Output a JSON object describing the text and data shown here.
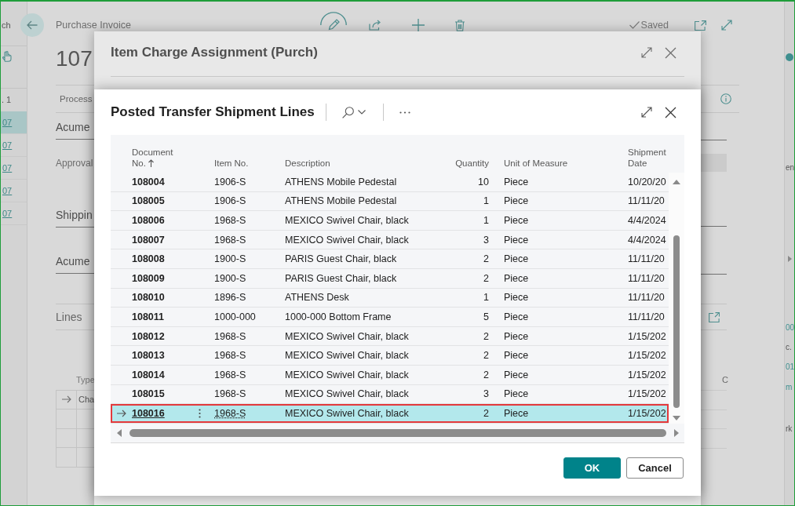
{
  "background_page": {
    "side_list": {
      "heading": "ch",
      "label": ". 1",
      "items": [
        {
          "text": "07",
          "selected": true
        },
        {
          "text": "07",
          "selected": false
        },
        {
          "text": "07",
          "selected": false
        },
        {
          "text": "07",
          "selected": false
        },
        {
          "text": "07",
          "selected": false
        }
      ]
    },
    "breadcrumb": "Purchase Invoice",
    "status": "Saved",
    "title": "107",
    "tab": "Process",
    "sections": [
      {
        "kind": "heading",
        "text": "Acume"
      },
      {
        "kind": "field",
        "text": "Approval"
      },
      {
        "kind": "heading",
        "text": "Shippin"
      },
      {
        "kind": "heading",
        "text": "Acume"
      },
      {
        "kind": "part",
        "text": "Lines"
      }
    ],
    "lines_grid": {
      "header": "Type",
      "cell": "Cha"
    },
    "right_column": {
      "label": "C"
    },
    "side_panel": [
      {
        "kind": "text",
        "text": "en"
      },
      {
        "kind": "link",
        "text": "00"
      },
      {
        "kind": "text",
        "text": "c."
      },
      {
        "kind": "link",
        "text": "01"
      },
      {
        "kind": "link",
        "text": "m"
      },
      {
        "kind": "text",
        "text": "rk"
      }
    ]
  },
  "back_dialog": {
    "title": "Item Charge Assignment (Purch)"
  },
  "dialog": {
    "title": "Posted Transfer Shipment Lines",
    "table": {
      "columns": [
        {
          "label": "Document No.",
          "sorted": true
        },
        {
          "label": "Item No.",
          "sorted": false
        },
        {
          "label": "Description",
          "sorted": false
        },
        {
          "label": "Quantity",
          "sorted": false
        },
        {
          "label": "Unit of Measure",
          "sorted": false
        },
        {
          "label": "Shipment Date",
          "sorted": false
        }
      ],
      "rows": [
        {
          "document_no": "108004",
          "item_no": "1906-S",
          "description": "ATHENS Mobile Pedestal",
          "quantity": "10",
          "unit_of_measure": "Piece",
          "shipment_date": "10/20/20",
          "selected": false,
          "highlighted": false
        },
        {
          "document_no": "108005",
          "item_no": "1906-S",
          "description": "ATHENS Mobile Pedestal",
          "quantity": "1",
          "unit_of_measure": "Piece",
          "shipment_date": "11/11/20",
          "selected": false,
          "highlighted": false
        },
        {
          "document_no": "108006",
          "item_no": "1968-S",
          "description": "MEXICO Swivel Chair, black",
          "quantity": "1",
          "unit_of_measure": "Piece",
          "shipment_date": "4/4/2024",
          "selected": false,
          "highlighted": false
        },
        {
          "document_no": "108007",
          "item_no": "1968-S",
          "description": "MEXICO Swivel Chair, black",
          "quantity": "3",
          "unit_of_measure": "Piece",
          "shipment_date": "4/4/2024",
          "selected": false,
          "highlighted": false
        },
        {
          "document_no": "108008",
          "item_no": "1900-S",
          "description": "PARIS Guest Chair, black",
          "quantity": "2",
          "unit_of_measure": "Piece",
          "shipment_date": "11/11/20",
          "selected": false,
          "highlighted": false
        },
        {
          "document_no": "108009",
          "item_no": "1900-S",
          "description": "PARIS Guest Chair, black",
          "quantity": "2",
          "unit_of_measure": "Piece",
          "shipment_date": "11/11/20",
          "selected": false,
          "highlighted": false
        },
        {
          "document_no": "108010",
          "item_no": "1896-S",
          "description": "ATHENS Desk",
          "quantity": "1",
          "unit_of_measure": "Piece",
          "shipment_date": "11/11/20",
          "selected": false,
          "highlighted": false
        },
        {
          "document_no": "108011",
          "item_no": "1000-000",
          "description": "1000-000 Bottom Frame",
          "quantity": "5",
          "unit_of_measure": "Piece",
          "shipment_date": "11/11/20",
          "selected": false,
          "highlighted": false
        },
        {
          "document_no": "108012",
          "item_no": "1968-S",
          "description": "MEXICO Swivel Chair, black",
          "quantity": "2",
          "unit_of_measure": "Piece",
          "shipment_date": "1/15/202",
          "selected": false,
          "highlighted": false
        },
        {
          "document_no": "108013",
          "item_no": "1968-S",
          "description": "MEXICO Swivel Chair, black",
          "quantity": "2",
          "unit_of_measure": "Piece",
          "shipment_date": "1/15/202",
          "selected": false,
          "highlighted": false
        },
        {
          "document_no": "108014",
          "item_no": "1968-S",
          "description": "MEXICO Swivel Chair, black",
          "quantity": "2",
          "unit_of_measure": "Piece",
          "shipment_date": "1/15/202",
          "selected": false,
          "highlighted": false
        },
        {
          "document_no": "108015",
          "item_no": "1968-S",
          "description": "MEXICO Swivel Chair, black",
          "quantity": "3",
          "unit_of_measure": "Piece",
          "shipment_date": "1/15/202",
          "selected": false,
          "highlighted": false
        },
        {
          "document_no": "108016",
          "item_no": "1968-S",
          "description": "MEXICO Swivel Chair, black",
          "quantity": "2",
          "unit_of_measure": "Piece",
          "shipment_date": "1/15/202",
          "selected": true,
          "highlighted": true
        }
      ]
    },
    "buttons": [
      {
        "kind": "primary",
        "label": "OK"
      },
      {
        "kind": "secondary",
        "label": "Cancel"
      }
    ]
  }
}
